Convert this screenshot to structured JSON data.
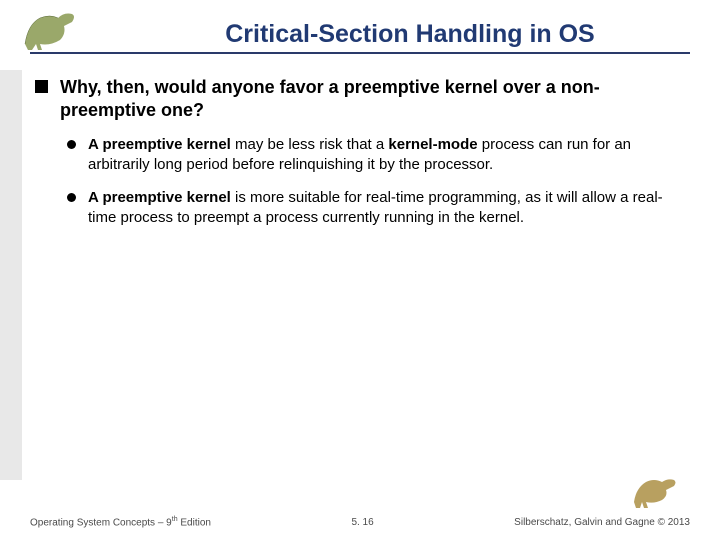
{
  "slide": {
    "title": "Critical-Section Handling in OS",
    "main_bullet": "Why, then, would anyone favor a preemptive kernel over a non-preemptive one?",
    "sub_bullets": [
      {
        "bold1": "A preemptive kernel",
        "mid1": " may be less risk that a ",
        "bold2": "kernel-mode",
        "tail": " process can run for an arbitrarily long period before relinquishing it by the processor."
      },
      {
        "bold1": "A preemptive kernel",
        "mid1": " is more suitable for real-time programming, as it will allow a real-time process to preempt a process currently running in the kernel.",
        "bold2": "",
        "tail": ""
      }
    ]
  },
  "footer": {
    "left_a": "Operating System Concepts – 9",
    "left_sup": "th",
    "left_b": " Edition",
    "center": "5. 16",
    "right": "Silberschatz, Galvin and Gagne © 2013"
  }
}
